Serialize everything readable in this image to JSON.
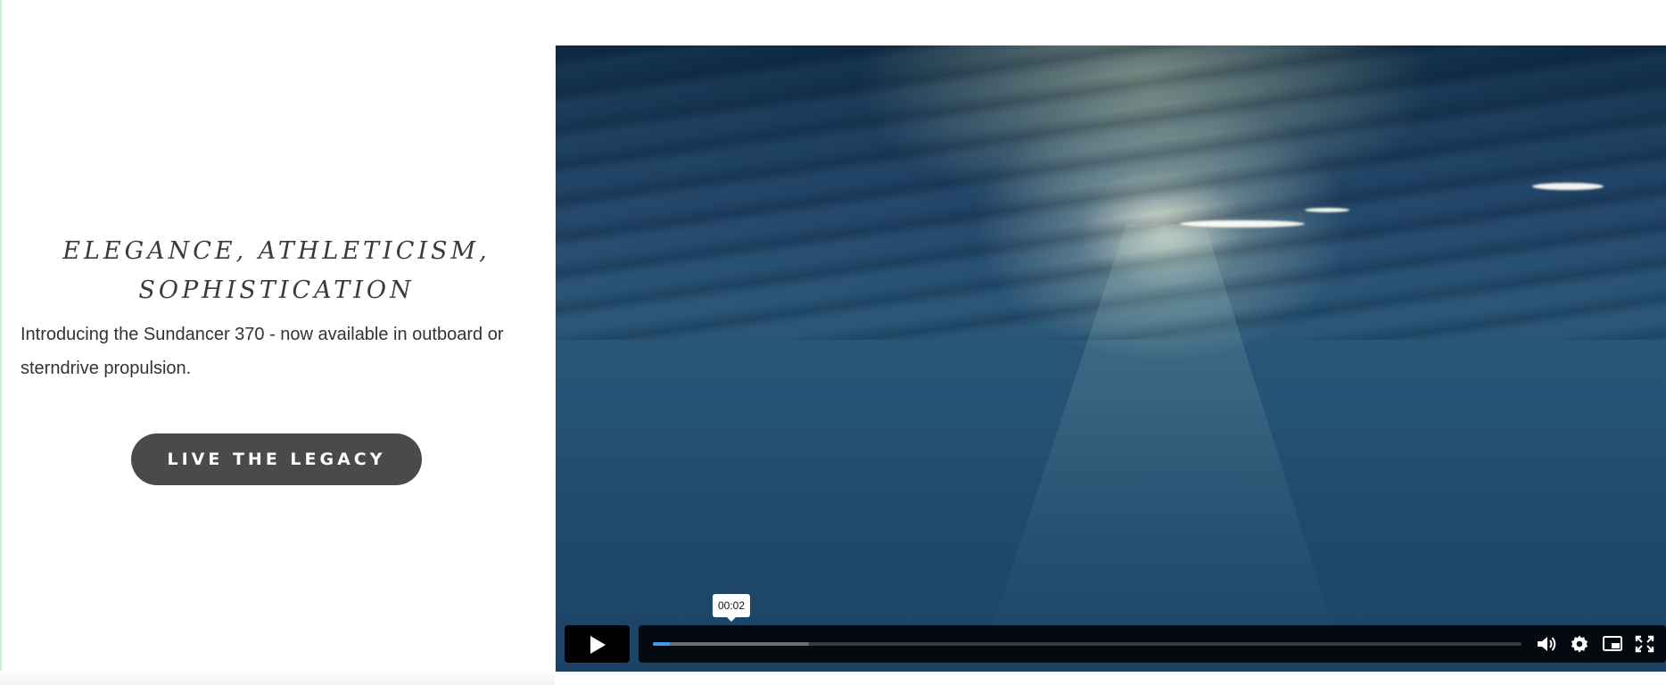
{
  "hero": {
    "headline": "ELEGANCE, ATHLETICISM, SOPHISTICATION",
    "description": "Introducing the Sundancer 370 - now available in outboard or sterndrive propulsion.",
    "cta_label": "LIVE THE LEGACY"
  },
  "video_player": {
    "current_time_tooltip": "00:02",
    "progress_fraction": 0.02,
    "buffered_fraction": 0.18,
    "controls": {
      "play_icon": "play-icon",
      "volume_icon": "volume-icon",
      "settings_icon": "gear-icon",
      "pip_icon": "picture-in-picture-icon",
      "fullscreen_icon": "fullscreen-icon"
    }
  },
  "colors": {
    "cta_background": "#4a4a4a",
    "progress_played": "#3d9bef",
    "video_water": "#1b4366"
  }
}
